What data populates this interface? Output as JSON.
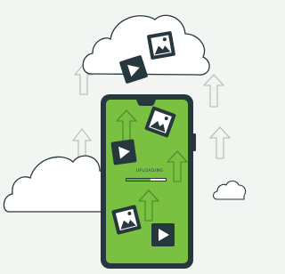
{
  "upload": {
    "label": "UPLOADING",
    "progress": 0.62
  },
  "icons": {
    "media_tile": "image-icon",
    "play_tile": "play-icon",
    "cloud": "cloud-icon",
    "arrow": "up-arrow-icon"
  },
  "colors": {
    "background": "#f3f5f2",
    "screen": "#7ac142",
    "phone_frame": "#26383d",
    "cloud_outline": "#26383d",
    "arrow_outline": "#b7c7b3",
    "progress_fill": "#5fb82e",
    "tile_dark": "#26383d"
  }
}
